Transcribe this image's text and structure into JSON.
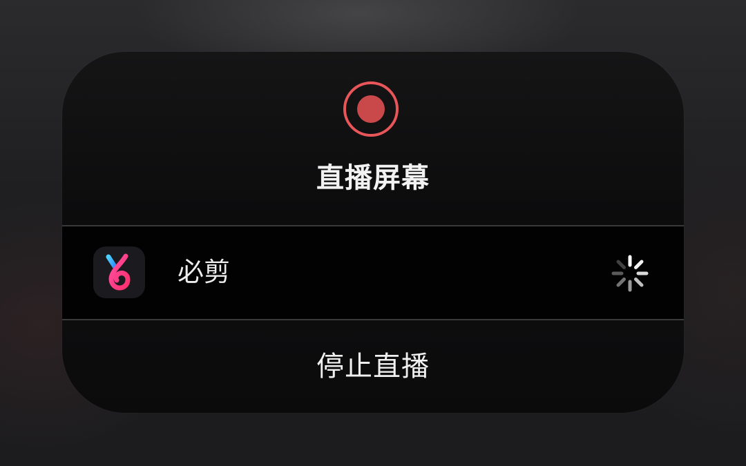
{
  "panel": {
    "title": "直播屏幕",
    "record_color": "#e9565a",
    "app": {
      "name": "必剪",
      "icon": "bijian-app-icon",
      "status_icon": "loading-spinner-icon"
    },
    "stop_label": "停止直播"
  }
}
